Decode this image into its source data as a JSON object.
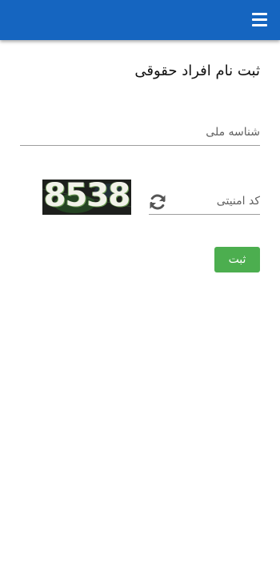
{
  "header": {
    "menu_icon": "menu-icon",
    "color": "#1565c0"
  },
  "form": {
    "title": "ثبت نام افراد حقوقی",
    "national_id": {
      "placeholder": "شناسه ملی",
      "value": ""
    },
    "security_code": {
      "placeholder": "کد امنیتی",
      "value": ""
    },
    "refresh_icon": "refresh-icon",
    "captcha_text": "8538",
    "submit_label": "ثبت",
    "submit_color": "#4cae4f"
  }
}
